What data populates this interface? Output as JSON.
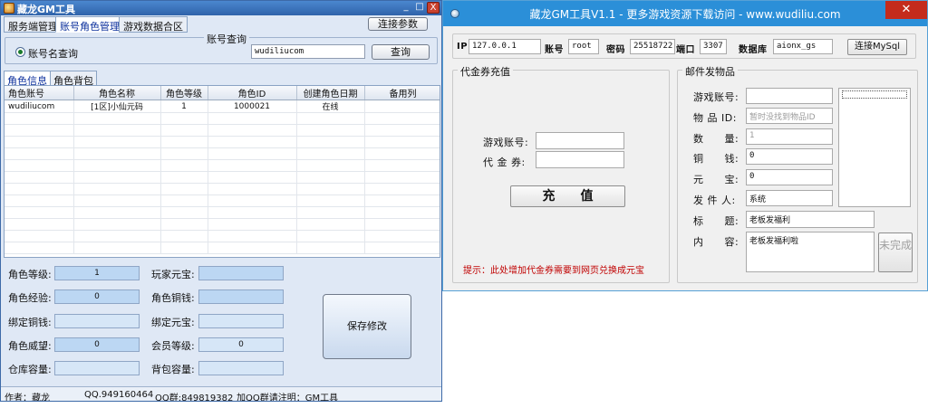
{
  "win1": {
    "title": "藏龙GM工具",
    "minimize": "_",
    "maximize": "□",
    "close": "X",
    "tabs": [
      "服务端管理",
      "账号角色管理",
      "游戏数据合区"
    ],
    "connect_btn": "连接参数",
    "query_group_title": "账号查询",
    "radio_label": "账号名查询",
    "query_value": "wudiliucom",
    "query_btn": "查询",
    "subtabs": [
      "角色信息",
      "角色背包"
    ],
    "grid": {
      "headers": [
        "角色账号",
        "角色名称",
        "角色等级",
        "角色ID",
        "创建角色日期",
        "备用列"
      ],
      "rows": [
        [
          "wudiliucom",
          "[1区]小仙元码",
          "1",
          "1000021",
          "在线",
          ""
        ]
      ]
    },
    "form": {
      "left": [
        {
          "label": "角色等级:",
          "value": "1"
        },
        {
          "label": "角色经验:",
          "value": "0"
        },
        {
          "label": "绑定铜钱:",
          "value": ""
        },
        {
          "label": "角色威望:",
          "value": "0"
        },
        {
          "label": "仓库容量:",
          "value": ""
        }
      ],
      "right": [
        {
          "label": "玩家元宝:",
          "value": ""
        },
        {
          "label": "角色铜钱:",
          "value": ""
        },
        {
          "label": "绑定元宝:",
          "value": ""
        },
        {
          "label": "会员等级:",
          "value": "0"
        },
        {
          "label": "背包容量:",
          "value": ""
        }
      ]
    },
    "save_btn": "保存修改",
    "status": {
      "author": "作者：藏龙",
      "qq": "QQ.949160464",
      "qq_group": "QQ群:849819382",
      "note": "加QQ群请注明：GM工具"
    }
  },
  "win2": {
    "title": "藏龙GM工具V1.1 - 更多游戏资源下载访问 - www.wudiliu.com",
    "close": "✕",
    "conn": {
      "ip_label": "IP",
      "ip_value": "127.0.0.1",
      "user_label": "账号",
      "user_value": "root",
      "pwd_label": "密码",
      "pwd_value": "25518722",
      "port_label": "端口",
      "port_value": "3307",
      "db_label": "数据库",
      "db_value": "aionx_gs",
      "connect_btn": "连接MySql"
    },
    "recharge": {
      "title": "代金券充值",
      "account_label": "游戏账号:",
      "account_value": "",
      "voucher_label": "代 金 券:",
      "voucher_value": "",
      "btn": "充　　值",
      "tip": "提示：此处增加代金券需要到网页兑换成元宝"
    },
    "mail": {
      "title": "邮件发物品",
      "fields": [
        {
          "label": "游戏账号:",
          "value": ""
        },
        {
          "label": "物 品 ID:",
          "value": "暂时没找到物品ID"
        },
        {
          "label": "数　　量:",
          "value": "1"
        },
        {
          "label": "铜　　钱:",
          "value": "0"
        },
        {
          "label": "元　　宝:",
          "value": "0"
        },
        {
          "label": "发 件 人:",
          "value": "系统"
        },
        {
          "label": "标　　题:",
          "value": "老板发福利"
        },
        {
          "label": "内　　容:",
          "value": "老板发福利啦"
        }
      ],
      "incomplete_btn": "未完成"
    }
  }
}
